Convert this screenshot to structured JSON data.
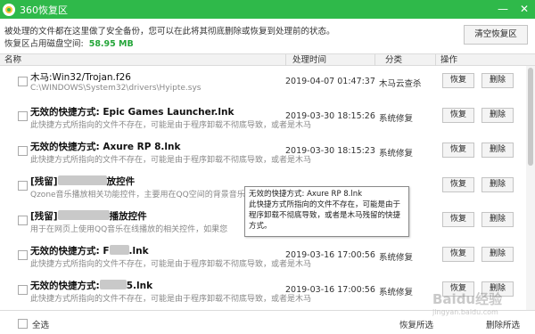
{
  "window": {
    "title": "360恢复区",
    "minimize": "—",
    "close": "✕"
  },
  "info_text": "被处理的文件都在这里做了安全备份，您可以在此将其彻底删除或恢复到处理前的状态。",
  "usage": {
    "label": "恢复区占用磁盘空间:",
    "size": "58.95 MB"
  },
  "clear_button": "清空恢复区",
  "columns": {
    "name": "名称",
    "time": "处理时间",
    "category": "分类",
    "action": "操作"
  },
  "rows": [
    {
      "name": "木马:Win32/Trojan.f26",
      "desc": "C:\\WINDOWS\\System32\\drivers\\Hyipte.sys",
      "time": "2019-04-07 01:47:37",
      "category": "木马云查杀",
      "restore": "恢复",
      "delete": "删除"
    },
    {
      "name": "无效的快捷方式: Epic Games Launcher.lnk",
      "desc": "此快捷方式所指向的文件不存在，可能是由于程序卸载不彻底导致，或者是木马",
      "time": "2019-03-30 18:15:26",
      "category": "系统修复",
      "restore": "恢复",
      "delete": "删除"
    },
    {
      "name": "无效的快捷方式: Axure RP 8.lnk",
      "desc": "此快捷方式所指向的文件不存在，可能是由于程序卸载不彻底导致，或者是木马",
      "time": "2019-03-30 18:15:23",
      "category": "系统修复",
      "restore": "恢复",
      "delete": "删除"
    },
    {
      "name_prefix": "[残留]",
      "name_suffix": "放控件",
      "desc": "Qzone音乐播放相关功能控件，主要用在QQ空间的背景音乐",
      "time": "",
      "category": "",
      "restore": "恢复",
      "delete": "删除"
    },
    {
      "name_prefix": "[残留]",
      "name_suffix": "播放控件",
      "desc": "用于在网页上使用QQ音乐在线播放的相关控件，如果您",
      "time": "",
      "category": "",
      "restore": "恢复",
      "delete": "删除"
    },
    {
      "name_prefix": "无效的快捷方式: F",
      "name_suffix": ".lnk",
      "desc": "此快捷方式所指向的文件不存在，可能是由于程序卸载不彻底导致，或者是木马",
      "time": "2019-03-16 17:00:56",
      "category": "系统修复",
      "restore": "恢复",
      "delete": "删除"
    },
    {
      "name_prefix": "无效的快捷方式:",
      "name_suffix": "5.lnk",
      "desc": "此快捷方式所指向的文件不存在，可能是由于程序卸载不彻底导致，或者是木马",
      "time": "2019-03-16 17:00:56",
      "category": "系统修复",
      "restore": "恢复",
      "delete": "删除"
    }
  ],
  "tooltip": {
    "text": "无效的快捷方式: Axure RP 8.lnk\n此快捷方式所指向的文件不存在，可能是由于程序卸载不彻底导致，或者是木马残留的快捷方式。"
  },
  "footer": {
    "select_all": "全选",
    "restore_selected": "恢复所选",
    "delete_selected": "删除所选"
  },
  "watermark": {
    "text": "Baidu经验",
    "sub": "jingyan.baidu.com"
  }
}
